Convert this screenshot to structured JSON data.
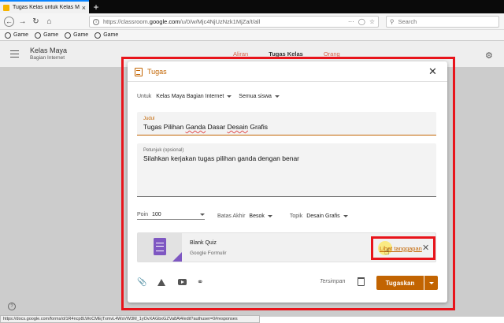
{
  "browser": {
    "tab_title": "Tugas Kelas untuk Kelas Maya",
    "tab_close": "×",
    "new_tab": "+",
    "url_prefix": "https://classroom.",
    "url_domain": "google.com",
    "url_path": "/u/0/w/Mjc4NjUzNzk1MjZa/t/all",
    "url_suffix": "···",
    "search_placeholder": "Search",
    "bookmarks": [
      "Game",
      "Game",
      "Game",
      "Game"
    ]
  },
  "classroom": {
    "class_name": "Kelas Maya",
    "class_section": "Bagian Internet",
    "tabs": [
      "Aliran",
      "Tugas Kelas",
      "Orang"
    ]
  },
  "dialog": {
    "title": "Tugas",
    "for_label": "Untuk",
    "class_select": "Kelas Maya Bagian Internet",
    "students_select": "Semua siswa",
    "title_label": "Judul",
    "title_value_pre": "Tugas Pilihan ",
    "title_value_err1": "Ganda",
    "title_value_mid": " Dasar ",
    "title_value_err2": "Desain",
    "title_value_post": " Grafis",
    "instructions_label": "Petunjuk (opsional)",
    "instructions_value": "Silahkan kerjakan tugas pilihan ganda dengan benar",
    "points_label": "Poin",
    "points_value": "100",
    "due_label": "Batas Akhir",
    "due_value": "Besok",
    "topic_label": "Topik",
    "topic_value": "Desain Grafis",
    "attachment_title": "Blank Quiz",
    "attachment_type": "Google Formulir",
    "view_responses": "Lihat tanggapan",
    "saved_text": "Tersimpan",
    "assign_button": "Tugaskan"
  },
  "status_url": "https://docs.google.com/forms/d/1R4ncp8LWoCMEjTxmvL4WsVW3M_1yOvXAGbxGZVa8Al4/edit?authuser=0#responses",
  "colors": {
    "accent": "#c26401",
    "highlight_frame": "#e8141b",
    "forms_purple": "#7e57c2"
  }
}
